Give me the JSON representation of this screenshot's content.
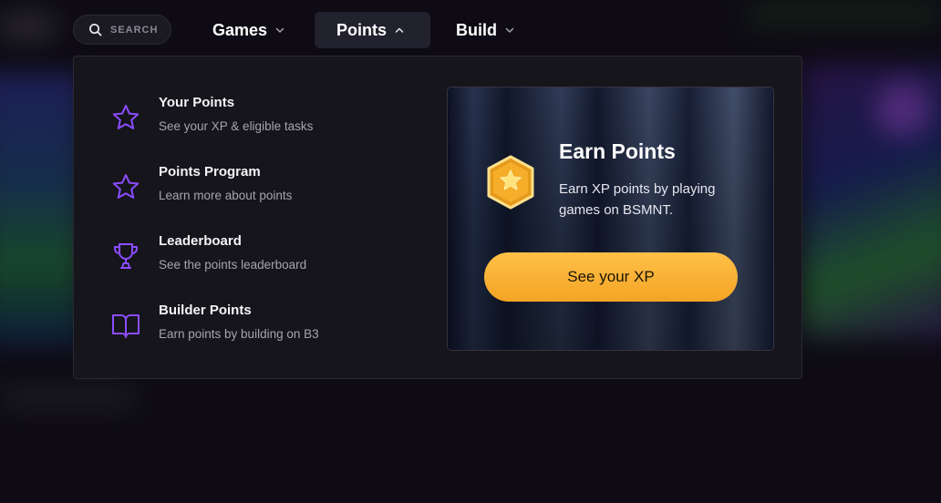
{
  "search": {
    "label": "SEARCH"
  },
  "nav": {
    "items": [
      {
        "label": "Games",
        "icon": "chevron-down-icon"
      },
      {
        "label": "Points",
        "icon": "chevron-up-icon",
        "active": true
      },
      {
        "label": "Build",
        "icon": "chevron-down-icon"
      }
    ]
  },
  "menu": {
    "items": [
      {
        "title": "Your Points",
        "description": "See your XP & eligible tasks",
        "icon": "star-icon"
      },
      {
        "title": "Points Program",
        "description": "Learn more about points",
        "icon": "star-icon"
      },
      {
        "title": "Leaderboard",
        "description": "See the points leaderboard",
        "icon": "trophy-icon"
      },
      {
        "title": "Builder Points",
        "description": "Earn points by building on B3",
        "icon": "book-icon"
      }
    ]
  },
  "promo": {
    "title": "Earn Points",
    "description": "Earn XP points by playing games on BSMNT.",
    "button_label": "See your XP",
    "icon": "star-badge-icon"
  },
  "colors": {
    "accent_purple": "#8b4dff",
    "cta_orange": "#f7ad2e",
    "panel_bg": "#16151b"
  }
}
